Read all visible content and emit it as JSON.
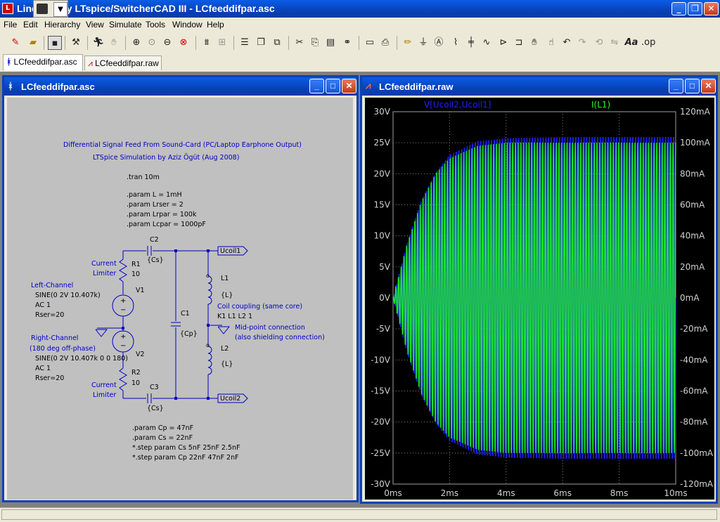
{
  "app": {
    "title": "Line    nology LTspice/SwitcherCAD III - LCfeeddifpar.asc"
  },
  "menu": [
    "File",
    "Edit",
    "Hierarchy",
    "View",
    "Simulate",
    "Tools",
    "Window",
    "Help"
  ],
  "tabs": [
    {
      "label": "LCfeeddifpar.asc",
      "active": true
    },
    {
      "label": "LCfeeddifpar.raw",
      "active": false
    }
  ],
  "schematic_window": {
    "title": "LCfeeddifpar.asc",
    "texts": {
      "heading1": "Differential Signal Feed From Sound-Card (PC/Laptop Earphone Output)",
      "heading2": "LTSpice Simulation by Aziz Ögüt (Aug 2008)",
      "tran": ".tran 10m",
      "p1": ".param L = 1mH",
      "p2": ".param Lrser = 2",
      "p3": ".param Lrpar = 100k",
      "p4": ".param Lcpar = 1000pF",
      "c2": "C2",
      "cs_top": "{Cs}",
      "ucoil1": "Ucoil1",
      "current_top": "Current",
      "limiter_top": "Limiter",
      "r1": "R1",
      "r1v": "10",
      "l1": "L1",
      "l1v": "{L}",
      "left_ch": "Left-Channel",
      "v1": "V1",
      "v1_sine": "SINE(0 2V 10.407k)",
      "v1_ac": "AC 1",
      "v1_rser": "Rser=20",
      "c1": "C1",
      "cp": "{Cp}",
      "coupling": "Coil coupling (same core)",
      "k1": "K1 L1 L2 1",
      "midpoint": "Mid-point connection",
      "shield": "(also shielding connection)",
      "right_ch": "Right-Channel",
      "phase": "(180 deg off-phase)",
      "v2": "V2",
      "v2_sine": "SINE(0 2V 10.407k 0 0 180)",
      "v2_ac": "AC 1",
      "v2_rser": "Rser=20",
      "l2": "L2",
      "l2v": "{L}",
      "r2": "R2",
      "r2v": "10",
      "current_bot": "Current",
      "limiter_bot": "Limiter",
      "c3": "C3",
      "cs_bot": "{Cs}",
      "ucoil2": "Ucoil2",
      "cp_param": ".param Cp = 47nF",
      "cs_param": ".param Cs = 22nF",
      "step1": "*.step param Cs 5nF 25nF 2.5nF",
      "step2": "*.step param Cp 22nF 47nF 2nF"
    }
  },
  "plot_window": {
    "title": "LCfeeddifpar.raw"
  },
  "chart_data": {
    "type": "line",
    "title": "",
    "xlabel": "",
    "x_ticks": [
      "0ms",
      "2ms",
      "4ms",
      "6ms",
      "8ms",
      "10ms"
    ],
    "xlim": [
      0,
      10
    ],
    "y_left_ticks": [
      "30V",
      "25V",
      "20V",
      "15V",
      "10V",
      "5V",
      "0V",
      "-5V",
      "-10V",
      "-15V",
      "-20V",
      "-25V",
      "-30V"
    ],
    "ylim_left": [
      -30,
      30
    ],
    "y_right_ticks": [
      "120mA",
      "100mA",
      "80mA",
      "60mA",
      "40mA",
      "20mA",
      "0mA",
      "-20mA",
      "-40mA",
      "-60mA",
      "-80mA",
      "-100mA",
      "-120mA"
    ],
    "ylim_right": [
      -120,
      120
    ],
    "grid": true,
    "series": [
      {
        "name": "V[Ucoil2,Ucoil1]",
        "color": "#2020ff",
        "axis": "left",
        "envelope_start": 0,
        "envelope_final": 26.5,
        "x": [
          0,
          0.5,
          1,
          1.5,
          2,
          3,
          4,
          6,
          8,
          10
        ],
        "envelope": [
          0,
          9,
          16,
          20.5,
          23.5,
          25.8,
          26.3,
          26.5,
          26.5,
          26.5
        ]
      },
      {
        "name": "I(L1)",
        "color": "#20ff20",
        "axis": "right",
        "envelope_final": 100,
        "x": [
          0,
          0.5,
          1,
          1.5,
          2,
          3,
          4,
          6,
          8,
          10
        ],
        "envelope": [
          0,
          35,
          62,
          80,
          90,
          98,
          100,
          100,
          100,
          100
        ]
      }
    ]
  },
  "colors": {
    "titlebar": "#0842b8",
    "plot_bg": "#000000",
    "voltage": "#2020ff",
    "current": "#20ff20",
    "schematic_bg": "#c0c0c0",
    "wire": "#0000c0"
  }
}
